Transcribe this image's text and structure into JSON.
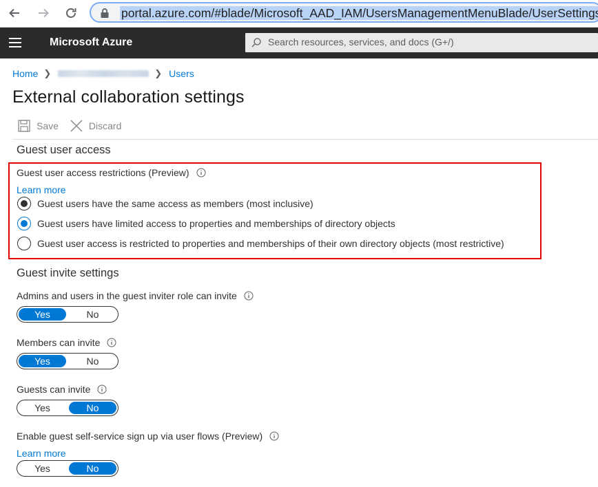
{
  "browser": {
    "url": "portal.azure.com/#blade/Microsoft_AAD_IAM/UsersManagementMenuBlade/UserSettings"
  },
  "header": {
    "brand": "Microsoft Azure",
    "search_placeholder": "Search resources, services, and docs (G+/)"
  },
  "breadcrumb": {
    "home": "Home",
    "users": "Users"
  },
  "page_title": "External collaboration settings",
  "toolbar": {
    "save": "Save",
    "discard": "Discard"
  },
  "guest_access": {
    "section_title": "Guest user access",
    "field_label": "Guest user access restrictions (Preview)",
    "learn_more": "Learn more",
    "options": [
      {
        "label": "Guest users have the same access as members (most inclusive)",
        "state": "selected-dark"
      },
      {
        "label": "Guest users have limited access to properties and memberships of directory objects",
        "state": "selected"
      },
      {
        "label": "Guest user access is restricted to properties and memberships of their own directory objects (most restrictive)",
        "state": "unselected"
      }
    ]
  },
  "guest_invite": {
    "section_title": "Guest invite settings",
    "settings": [
      {
        "label": "Admins and users in the guest inviter role can invite",
        "yes": "Yes",
        "no": "No",
        "value": "Yes"
      },
      {
        "label": "Members can invite",
        "yes": "Yes",
        "no": "No",
        "value": "Yes"
      },
      {
        "label": "Guests can invite",
        "yes": "Yes",
        "no": "No",
        "value": "No"
      },
      {
        "label": "Enable guest self-service sign up via user flows (Preview)",
        "learn_more": "Learn more",
        "yes": "Yes",
        "no": "No",
        "value": "No"
      }
    ]
  },
  "colors": {
    "accent": "#0078d4",
    "header_bg": "#2c2b2b",
    "highlight": "#e00000"
  }
}
